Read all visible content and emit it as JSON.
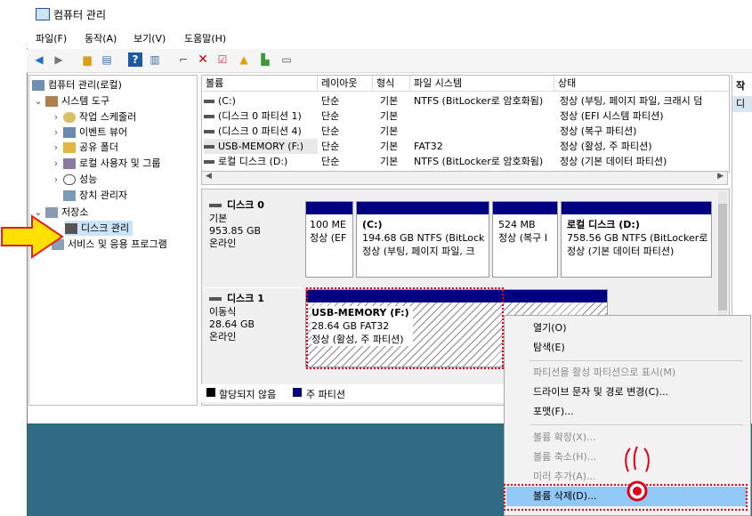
{
  "window": {
    "title": "컴퓨터 관리"
  },
  "menu": [
    "파일(F)",
    "동작(A)",
    "보기(V)",
    "도움말(H)"
  ],
  "toolbar_icons": [
    "back-icon",
    "forward-icon",
    "up-folder-icon",
    "properties-icon",
    "help-icon",
    "view-icon",
    "connect-icon",
    "delete-icon",
    "check-icon",
    "import-icon",
    "export-icon",
    "settings-icon"
  ],
  "tree": {
    "root": "컴퓨터 관리(로컬)",
    "system_tools": "시스템 도구",
    "items": [
      "작업 스케줄러",
      "이벤트 뷰어",
      "공유 폴더",
      "로컬 사용자 및 그룹",
      "성능",
      "장치 관리자"
    ],
    "storage": "저장소",
    "disk_mgmt": "디스크 관리",
    "services": "서비스 및 응용 프로그램"
  },
  "volume_list": {
    "headers": [
      "볼륨",
      "레이아웃",
      "형식",
      "파일 시스템",
      "상태"
    ],
    "rows": [
      [
        "(C:)",
        "단순",
        "기본",
        "NTFS (BitLocker로 암호화됨)",
        "정상 (부팅, 페이지 파일, 크래시 덤"
      ],
      [
        "(디스크 0 파티션 1)",
        "단순",
        "기본",
        "",
        "정상 (EFI 시스템 파티션)"
      ],
      [
        "(디스크 0 파티션 4)",
        "단순",
        "기본",
        "",
        "정상 (복구 파티션)"
      ],
      [
        "USB-MEMORY (F:)",
        "단순",
        "기본",
        "FAT32",
        "정상 (활성, 주 파티션)"
      ],
      [
        "로컬 디스크 (D:)",
        "단순",
        "기본",
        "NTFS (BitLocker로 암호화됨)",
        "정상 (기본 데이터 파티션)"
      ]
    ]
  },
  "disk0": {
    "name": "디스크 0",
    "type": "기본",
    "size": "953.85 GB",
    "status": "온라인",
    "partitions": [
      {
        "title": "",
        "line1": "100 ME",
        "line2": "정상 (EF"
      },
      {
        "title": "(C:)",
        "line1": "194.68 GB NTFS (BitLock",
        "line2": "정상 (부팅, 페이지 파일, 크"
      },
      {
        "title": "",
        "line1": "524 MB",
        "line2": "정상 (복구 I"
      },
      {
        "title": "로컬 디스크   (D:)",
        "line1": "758.56 GB NTFS (BitLocker로",
        "line2": "정상 (기본 데이터 파티션)"
      }
    ]
  },
  "disk1": {
    "name": "디스크 1",
    "type": "이동식",
    "size": "28.64 GB",
    "status": "온라인",
    "partition": {
      "title": "USB-MEMORY  (F:)",
      "line1": "28.64 GB FAT32",
      "line2": "정상 (활성, 주 파티션)"
    }
  },
  "legend": {
    "unallocated": "할당되지 않음",
    "primary": "주 파티션"
  },
  "right_panel": {
    "header": "작",
    "item": "디"
  },
  "context_menu": {
    "items": [
      {
        "label": "열기(O)",
        "enabled": true
      },
      {
        "label": "탐색(E)",
        "enabled": true
      },
      {
        "label": "파티션을 활성 파티션으로 표시(M)",
        "enabled": false
      },
      {
        "label": "드라이브 문자 및 경로 변경(C)...",
        "enabled": true
      },
      {
        "label": "포맷(F)...",
        "enabled": true
      },
      {
        "label": "볼륨 확장(X)...",
        "enabled": false
      },
      {
        "label": "볼륨 축소(H)...",
        "enabled": false
      },
      {
        "label": "미러 추가(A)...",
        "enabled": false
      },
      {
        "label": "볼륨 삭제(D)...",
        "enabled": true
      }
    ]
  },
  "colors": {
    "primary_partition": "#000080",
    "selection": "#cce4f7",
    "highlight": "#91c9f7",
    "annotation_red": "#e0001b",
    "arrow_yellow": "#ffe000",
    "desktop": "#2f6c83"
  }
}
